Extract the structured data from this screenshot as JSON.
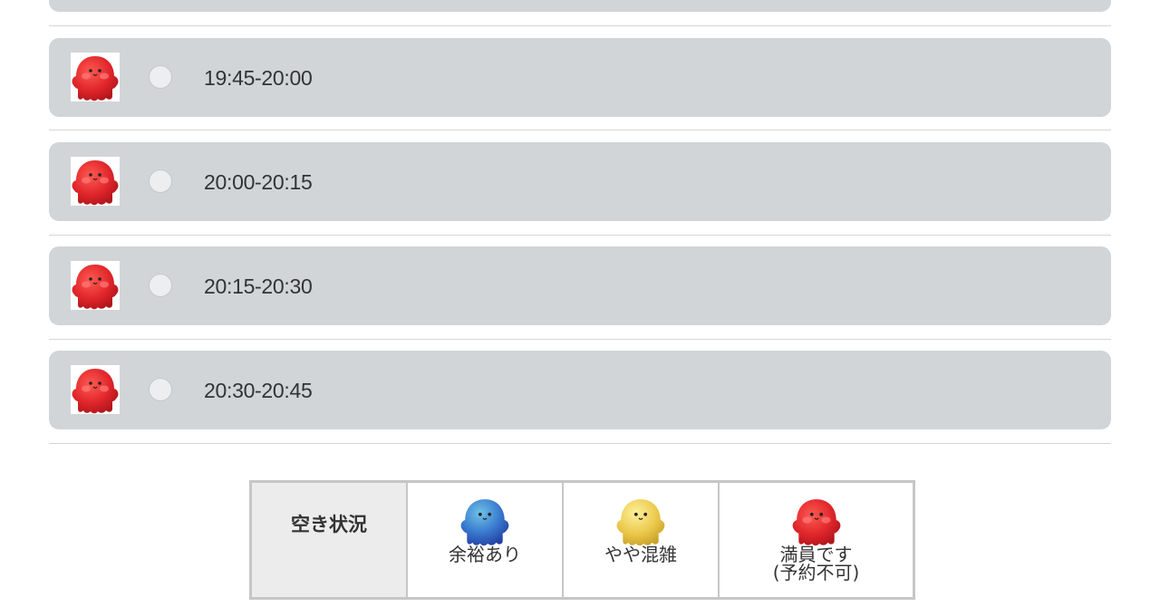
{
  "slots": [
    {
      "time": "19:45-20:00",
      "status_icon": "red-mascot-icon"
    },
    {
      "time": "20:00-20:15",
      "status_icon": "red-mascot-icon"
    },
    {
      "time": "20:15-20:30",
      "status_icon": "red-mascot-icon"
    },
    {
      "time": "20:30-20:45",
      "status_icon": "red-mascot-icon"
    }
  ],
  "legend": {
    "header": "空き状況",
    "items": [
      {
        "label": "余裕あり",
        "icon": "blue-mascot-icon",
        "color": "#3d6fc4"
      },
      {
        "label": "やや混雑",
        "icon": "yellow-mascot-icon",
        "color": "#e8c64a"
      },
      {
        "label": "満員です",
        "label2": "(予約不可)",
        "icon": "red-mascot-icon",
        "color": "#e0262b"
      }
    ]
  },
  "colors": {
    "row_background": "#d1d5d8",
    "full": "#e0262b",
    "some": "#e8c64a",
    "free": "#3d6fc4"
  }
}
